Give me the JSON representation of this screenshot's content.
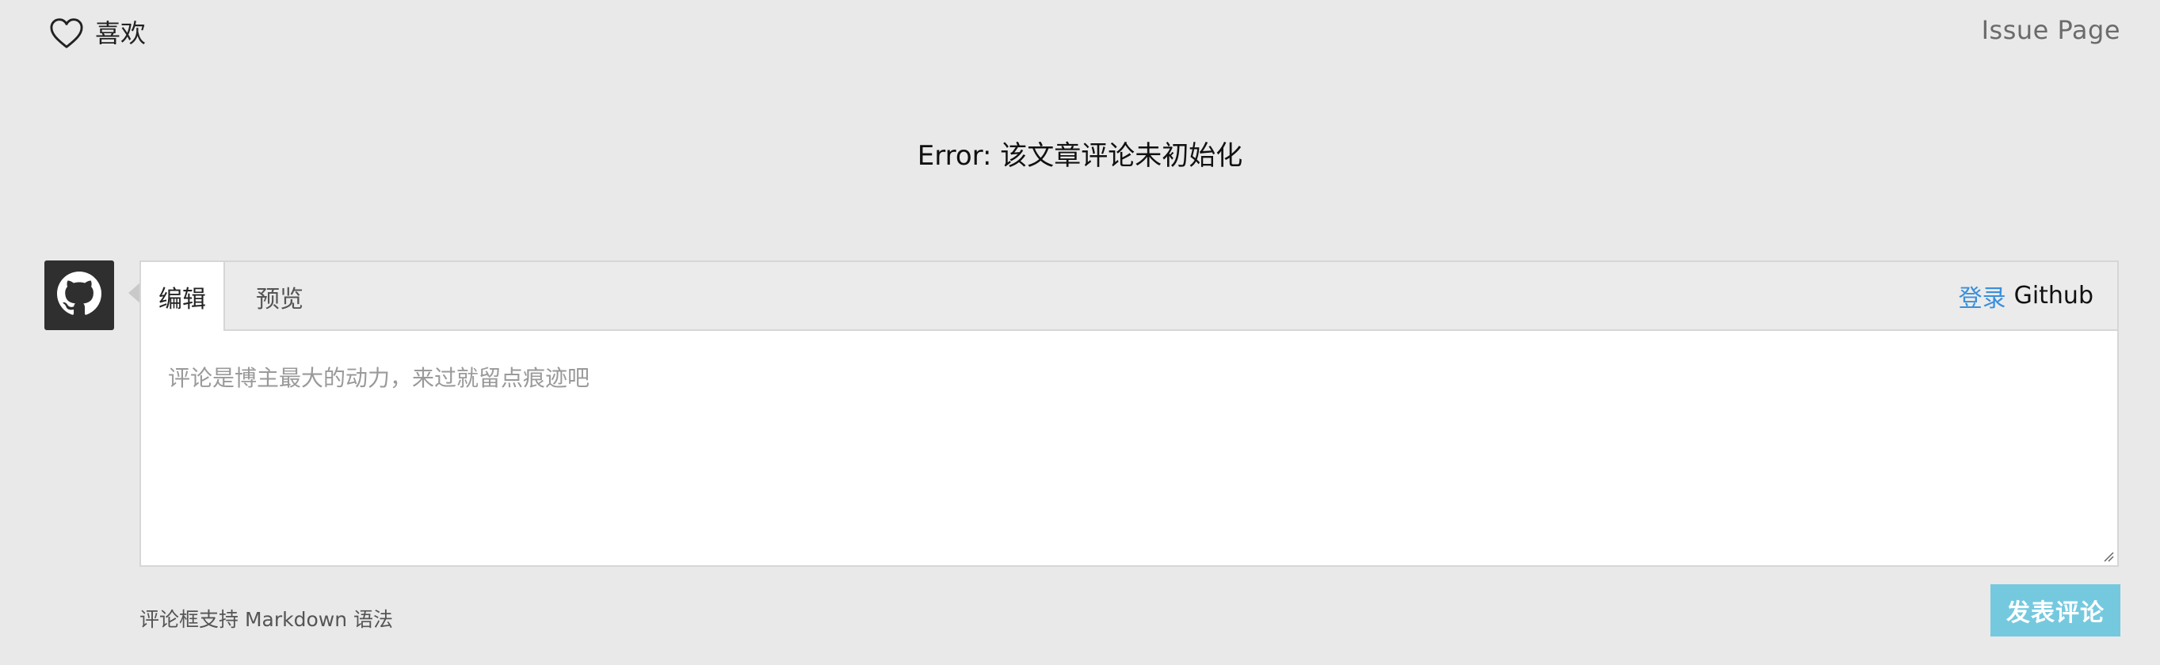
{
  "header": {
    "like_label": "喜欢",
    "issue_link": "Issue Page"
  },
  "error_message": "Error: 该文章评论未初始化",
  "editor": {
    "tabs": [
      {
        "label": "编辑",
        "active": true
      },
      {
        "label": "预览",
        "active": false
      }
    ],
    "login_link": "登录",
    "login_provider": "Github",
    "placeholder": "评论是博主最大的动力，来过就留点痕迹吧"
  },
  "footer": {
    "hint": "评论框支持 Markdown 语法",
    "submit_label": "发表评论"
  },
  "colors": {
    "background": "#e9e9e9",
    "link": "#3b8fdb",
    "submit": "#75c9df",
    "avatar": "#2f2f2f"
  },
  "icons": {
    "like": "heart-outline-icon",
    "avatar": "github-octocat-icon"
  }
}
